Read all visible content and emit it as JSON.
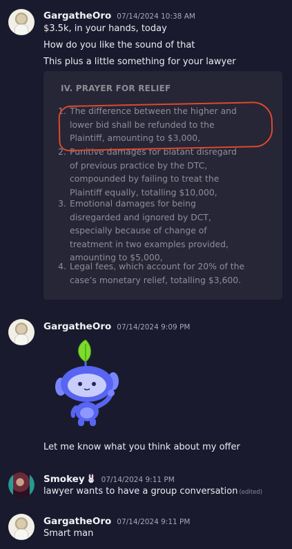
{
  "messages": [
    {
      "user": "GargatheOro",
      "time": "07/14/2024 10:38 AM",
      "lines": [
        "$3.5k, in your hands, today",
        "How do you like the sound of that",
        "This plus a little something for your lawyer"
      ],
      "embed": {
        "title": "IV. PRAYER FOR RELIEF",
        "items": [
          {
            "num": "1.",
            "lines": [
              "The difference between the higher and",
              "lower bid shall be refunded to the",
              "Plaintiff, amounting to $3,000,"
            ]
          },
          {
            "num": "2.",
            "lines": [
              "Punitive damages for blatant disregard",
              "of previous practice by the DTC,",
              "compounded by failing to treat the",
              "Plaintiff equally, totalling $10,000,"
            ]
          },
          {
            "num": "3.",
            "lines": [
              "Emotional damages for being",
              "disregarded and ignored by DCT,",
              "especially because of change of",
              "treatment in two examples provided,",
              "amounting to $5,000,"
            ]
          },
          {
            "num": "4.",
            "lines": [
              "Legal fees, which account for 20% of the",
              "case’s monetary relief, totalling $3,600."
            ]
          }
        ]
      }
    },
    {
      "user": "GargatheOro",
      "time": "07/14/2024 9:09 PM",
      "sticker": "wumpus-waving-sticker",
      "lines": [
        "Let me know what you think about my offer"
      ]
    },
    {
      "user": "Smokey",
      "user_badge": "rabbit-icon",
      "time": "07/14/2024 9:11 PM",
      "lines": [
        "lawyer wants to have a group conversation"
      ],
      "edited": "(edited)"
    },
    {
      "user": "GargatheOro",
      "time": "07/14/2024 9:11 PM",
      "lines": [
        "Smart man"
      ]
    }
  ],
  "colors": {
    "background": "#1a1a2e",
    "embed_bg": "#262636",
    "annotation_red": "#e2482c",
    "sticker_leaf": "#7cdc2c",
    "sticker_body": "#5865f2"
  }
}
